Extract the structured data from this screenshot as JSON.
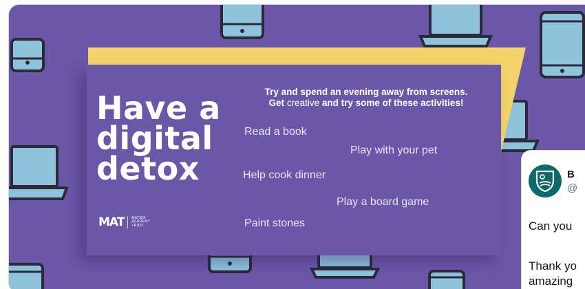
{
  "colors": {
    "background": "#6b57a7",
    "panel": "#6a57a8",
    "accent_yellow": "#f3d46a",
    "device_blue": "#8fc3dc",
    "device_outline": "#2a2a3a",
    "account_teal": "#0e6a6a"
  },
  "poster": {
    "title_lines": [
      "Have a",
      "digital",
      "detox"
    ],
    "intro_line1": "Try and spend an evening away from screens.",
    "intro_get": "Get",
    "intro_creative": "creative",
    "intro_rest": "and try some of these activities!",
    "activities": [
      "Read a book",
      "Play with your pet",
      "Help cook dinner",
      "Play a board game",
      "Paint stones"
    ],
    "logo_mark": "MAT",
    "logo_text_lines": [
      "MATRIX",
      "ACADEMY",
      "TRUST"
    ]
  },
  "tweet": {
    "name": "B",
    "handle": "@",
    "avatar_icon": "shield-crest-icon",
    "line1": "Can you",
    "line2": "Thank yo",
    "line3": "amazing"
  }
}
